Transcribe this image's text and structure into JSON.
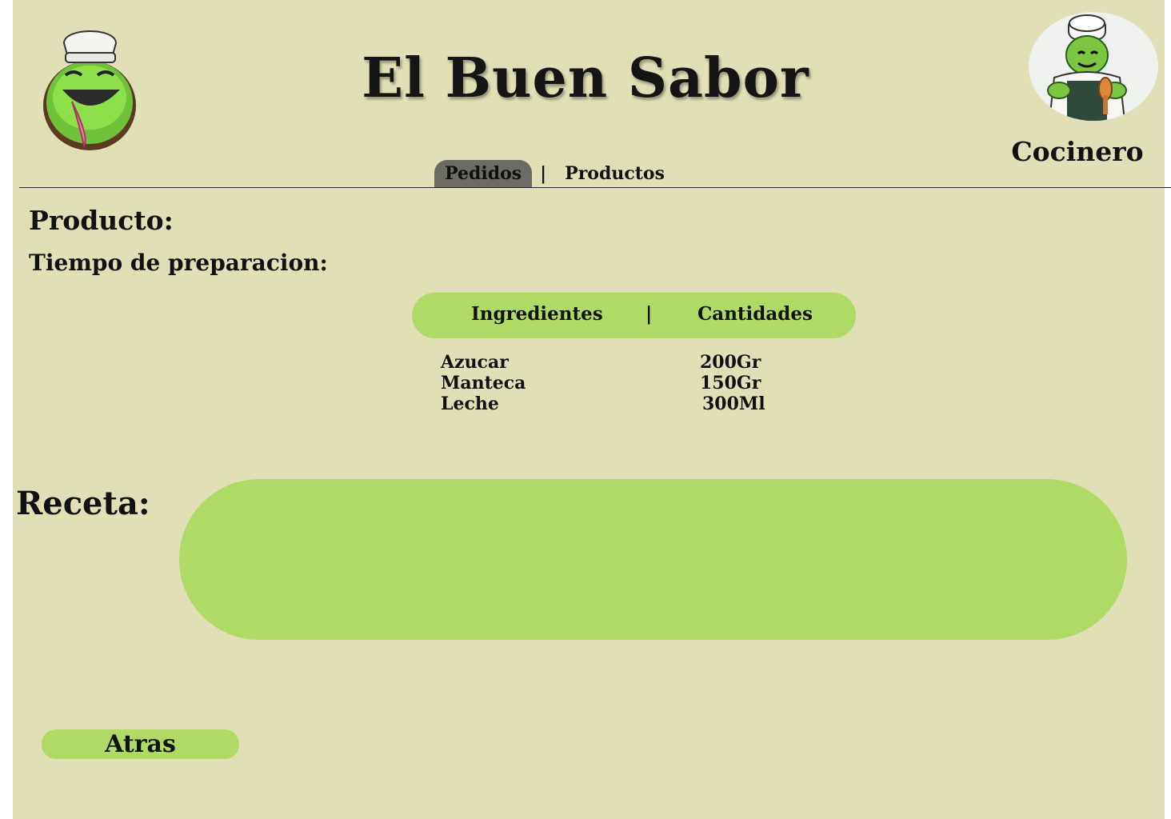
{
  "header": {
    "brand_title": "El Buen Sabor",
    "user_role": "Cocinero",
    "logo_icon": "ogre-chef-logo-icon",
    "avatar_icon": "ogre-chef-avatar-icon"
  },
  "nav": {
    "tabs": [
      {
        "label": "Pedidos",
        "active": true
      },
      {
        "label": "Productos",
        "active": false
      }
    ],
    "separator": "|"
  },
  "product": {
    "product_label": "Producto:",
    "time_label": "Tiempo de preparacion:"
  },
  "ingredients": {
    "header_ingredients": "Ingredientes",
    "header_separator": "|",
    "header_quantities": "Cantidades",
    "rows": [
      {
        "name": "Azucar",
        "qty": "200Gr"
      },
      {
        "name": "Manteca",
        "qty": "150Gr"
      },
      {
        "name": "Leche",
        "qty": "300Ml"
      }
    ]
  },
  "recipe": {
    "label": "Receta:"
  },
  "actions": {
    "back_label": "Atras"
  },
  "colors": {
    "background": "#e0dfb5",
    "accent_green": "#b0da66",
    "active_tab": "#6c6c64"
  }
}
